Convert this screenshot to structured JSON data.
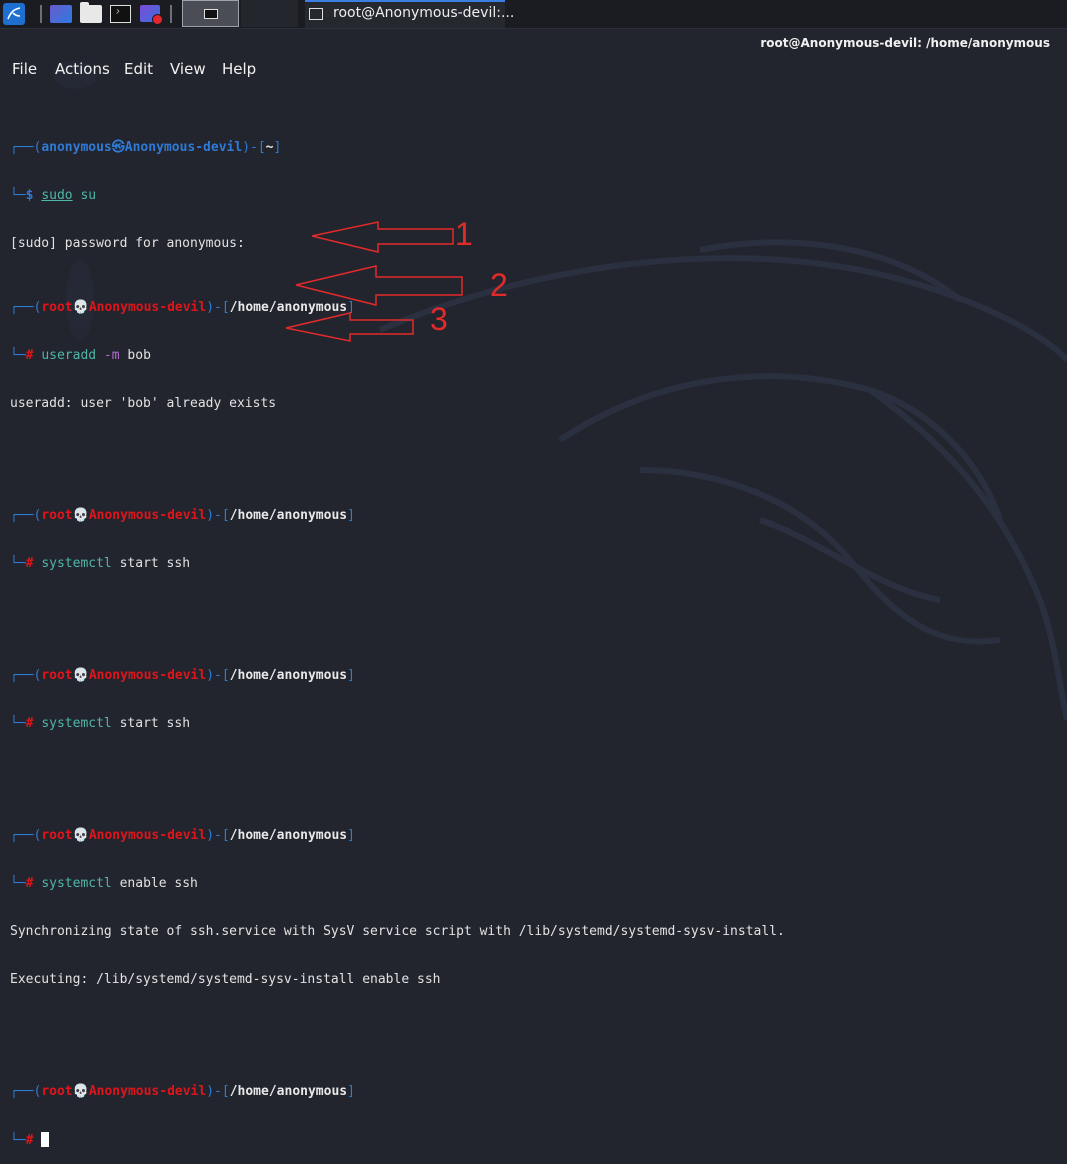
{
  "panel": {
    "task_title": "root@Anonymous-devil:..."
  },
  "window": {
    "title": "root@Anonymous-devil: /home/anonymous"
  },
  "menu": {
    "file": "File",
    "actions": "Actions",
    "edit": "Edit",
    "view": "View",
    "help": "Help"
  },
  "terminal": {
    "frame_top": "┌──(",
    "frame_bot": "└─",
    "prompt_user": "anonymous",
    "prompt_sym_user": "㉿",
    "prompt_root": "root",
    "prompt_sym_root": "💀",
    "host": "Anonymous-devil",
    "mid": ")-[",
    "close": "]",
    "home": "~",
    "root_path": "/home/anonymous",
    "dollar": "$ ",
    "hash": "# ",
    "cmd1_a": "sudo",
    "cmd1_b": " su",
    "out_sudo": "[sudo] password for anonymous:",
    "cmd2_a": "useradd",
    "cmd2_b": " -m",
    "cmd2_c": " bob",
    "out_useradd": "useradd: user 'bob' already exists",
    "cmd3_a": "systemctl",
    "cmd3_b": " start ssh",
    "cmd4_a": "systemctl",
    "cmd4_b": " start ssh",
    "cmd5_a": "systemctl",
    "cmd5_b": " enable ssh",
    "out_sync": "Synchronizing state of ssh.service with SysV service script with /lib/systemd/systemd-sysv-install.",
    "out_exec": "Executing: /lib/systemd/systemd-sysv-install enable ssh"
  },
  "annotations": {
    "n1": "1",
    "n2": "2",
    "n3": "3",
    "color": "#e32a2a"
  },
  "colors": {
    "background": "#22252e",
    "prompt_blue": "#2e7ad6",
    "root_red": "#e0141b",
    "command_teal": "#4fb6a8"
  }
}
